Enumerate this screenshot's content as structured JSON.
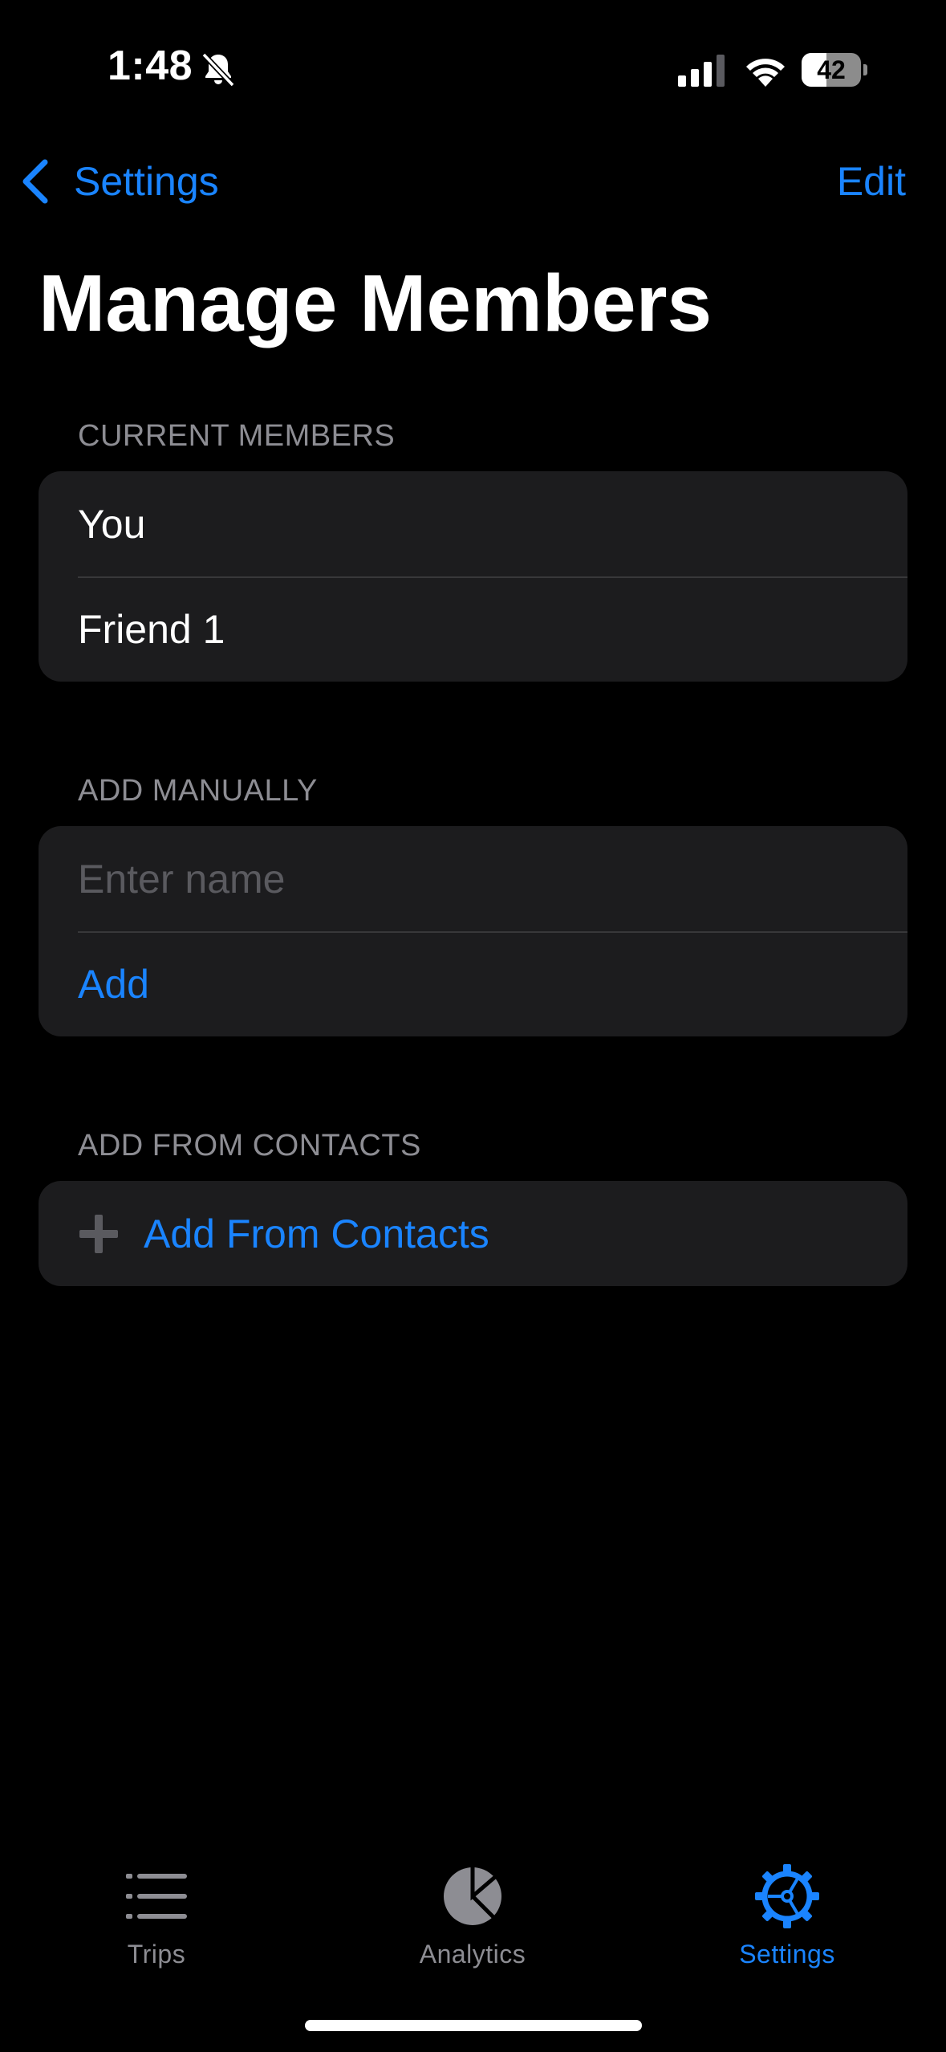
{
  "status_bar": {
    "time": "1:48",
    "battery_level": "42",
    "battery_fraction": 0.42
  },
  "nav": {
    "back_label": "Settings",
    "edit_label": "Edit"
  },
  "page": {
    "title": "Manage Members"
  },
  "sections": {
    "current_members": {
      "header": "CURRENT MEMBERS",
      "members": [
        "You",
        "Friend 1"
      ]
    },
    "add_manually": {
      "header": "ADD MANUALLY",
      "name_placeholder": "Enter name",
      "name_value": "",
      "add_label": "Add"
    },
    "add_from_contacts": {
      "header": "ADD FROM CONTACTS",
      "button_label": "Add From Contacts"
    }
  },
  "tab_bar": {
    "items": [
      {
        "label": "Trips",
        "icon": "list-icon"
      },
      {
        "label": "Analytics",
        "icon": "pie-chart-icon"
      },
      {
        "label": "Settings",
        "icon": "gear-icon"
      }
    ],
    "active": "Settings"
  },
  "colors": {
    "accent": "#1a84ff",
    "background": "#000000",
    "group_background": "#1c1c1e",
    "secondary_text": "#8d8d93"
  }
}
